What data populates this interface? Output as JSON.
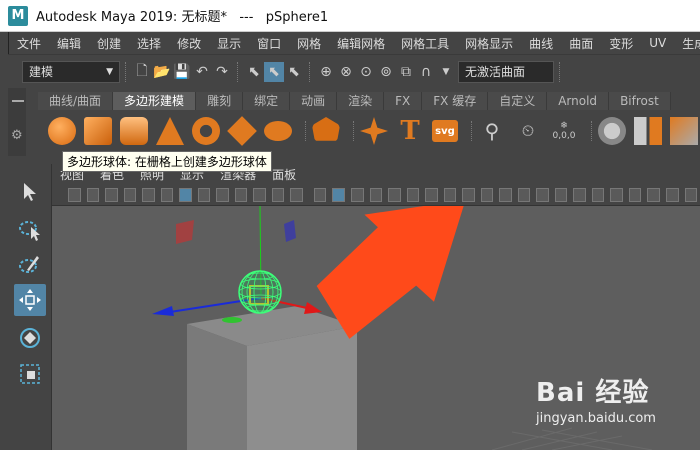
{
  "window": {
    "title": "Autodesk Maya 2019: 无标题*   ---   pSphere1"
  },
  "menubar": {
    "items": [
      "文件",
      "编辑",
      "创建",
      "选择",
      "修改",
      "显示",
      "窗口",
      "网格",
      "编辑网格",
      "网格工具",
      "网格显示",
      "曲线",
      "曲面",
      "变形",
      "UV",
      "生成"
    ]
  },
  "statusline": {
    "mode": "建模",
    "live_surface": "无激活曲面"
  },
  "shelf": {
    "tabs": [
      "曲线/曲面",
      "多边形建模",
      "雕刻",
      "绑定",
      "动画",
      "渲染",
      "FX",
      "FX 缓存",
      "自定义",
      "Arnold",
      "Bifrost"
    ],
    "active_tab": 1
  },
  "tooltip": {
    "text": "多边形球体: 在栅格上创建多边形球体"
  },
  "panel_menu": {
    "items": [
      "视图",
      "着色",
      "照明",
      "显示",
      "渲染器",
      "面板"
    ]
  },
  "shelf_text_tool": "T",
  "shelf_svg_tool": "svg",
  "shelf_counter": "0,0,0",
  "watermark": {
    "brand": "Bai 经验",
    "url": "jingyan.baidu.com"
  },
  "colors": {
    "accent": "#5285a6",
    "arrow": "#ff4a1a",
    "sphere": "#3dff7a",
    "gizmo_x": "#e01818",
    "gizmo_y": "#19d119",
    "gizmo_z": "#1a2bd9"
  }
}
